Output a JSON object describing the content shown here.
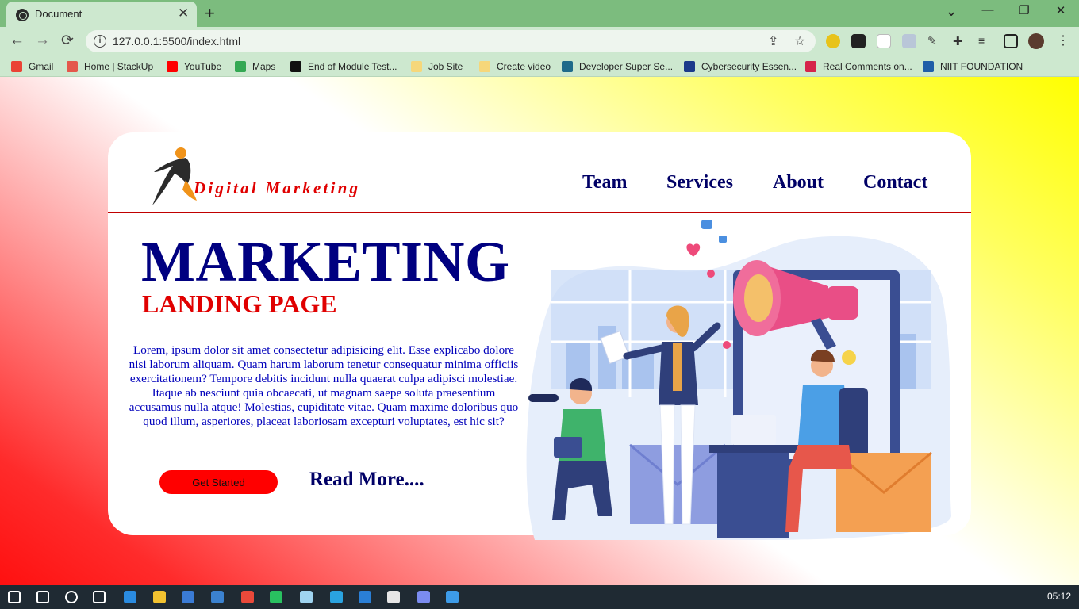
{
  "browser": {
    "tab_title": "Document",
    "tab_close": "✕",
    "new_tab": "+",
    "url": "127.0.0.1:5500/index.html",
    "window_controls": {
      "minimize": "—",
      "restore": "❐",
      "close": "✕"
    },
    "nav_glyphs": {
      "back": "←",
      "forward": "→",
      "reload": "⟳",
      "dropdown": "⌄"
    },
    "bookmarks": [
      {
        "label": "Gmail",
        "color": "#ea4335"
      },
      {
        "label": "Home | StackUp",
        "color": "#e4574b"
      },
      {
        "label": "YouTube",
        "color": "#ff0000"
      },
      {
        "label": "Maps",
        "color": "#34a853"
      },
      {
        "label": "End of Module Test...",
        "color": "#111111"
      },
      {
        "label": "Job Site",
        "color": "#f6d77a"
      },
      {
        "label": "Create video",
        "color": "#f6d77a"
      },
      {
        "label": "Developer Super Se...",
        "color": "#1f6b8a"
      },
      {
        "label": "Cybersecurity Essen...",
        "color": "#1b3a8a"
      },
      {
        "label": "Real Comments on...",
        "color": "#d6244a"
      },
      {
        "label": "NIIT FOUNDATION",
        "color": "#1f5ea8"
      }
    ]
  },
  "page": {
    "logo_text": "Digital Marketing",
    "nav": [
      "Team",
      "Services",
      "About",
      "Contact"
    ],
    "hero_title": "MARKETING",
    "hero_subtitle": "LANDING PAGE",
    "hero_body": "Lorem, ipsum dolor sit amet consectetur adipisicing elit. Esse explicabo dolore nisi laborum aliquam. Quam harum laborum tenetur consequatur minima officiis exercitationem? Tempore debitis incidunt nulla quaerat culpa adipisci molestiae. Itaque ab nesciunt quia obcaecati, ut magnam saepe soluta praesentium accusamus nulla atque! Molestias, cupiditate vitae. Quam maxime doloribus quo quod illum, asperiores, placeat laboriosam excepturi voluptates, est hic sit?",
    "cta_label": "Get Started",
    "readmore_label": "Read More....",
    "colors": {
      "title": "#000080",
      "accent": "#e00000",
      "body": "#0000bb",
      "button": "#ff0000"
    }
  },
  "taskbar": {
    "clock": "05:12",
    "apps": [
      "start-icon",
      "search-icon",
      "cortana-icon",
      "task-view-icon",
      "edge-icon",
      "file-explorer-icon",
      "store-icon",
      "mail-icon",
      "chrome-icon",
      "whatsapp-icon",
      "notepad-icon",
      "telegram-icon",
      "vscode-icon",
      "settings-icon",
      "app-icon",
      "photos-icon"
    ]
  }
}
